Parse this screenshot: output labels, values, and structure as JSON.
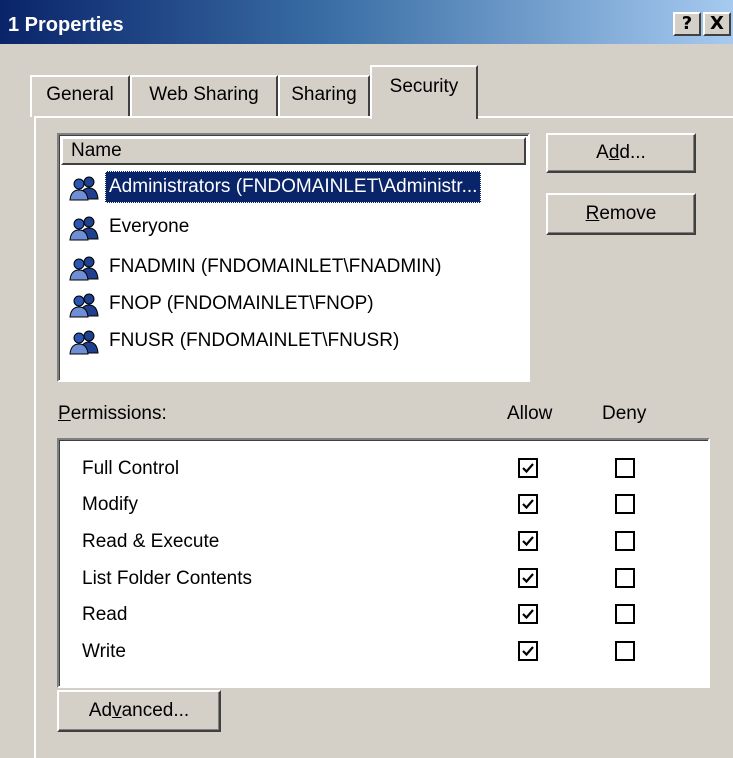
{
  "window": {
    "title": "1 Properties",
    "help_button": "?",
    "close_button": "X"
  },
  "tabs": [
    {
      "label": "General",
      "active": false
    },
    {
      "label": "Web Sharing",
      "active": false
    },
    {
      "label": "Sharing",
      "active": false
    },
    {
      "label": "Security",
      "active": true
    }
  ],
  "names_list": {
    "header": "Name",
    "items": [
      {
        "label": "Administrators (FNDOMAINLET\\Administr...",
        "icon": "group-icon",
        "selected": true
      },
      {
        "label": "Everyone",
        "icon": "group-icon",
        "selected": false
      },
      {
        "label": "FNADMIN (FNDOMAINLET\\FNADMIN)",
        "icon": "group-icon",
        "selected": false
      },
      {
        "label": "FNOP (FNDOMAINLET\\FNOP)",
        "icon": "group-icon",
        "selected": false
      },
      {
        "label": "FNUSR (FNDOMAINLET\\FNUSR)",
        "icon": "group-icon",
        "selected": false
      }
    ]
  },
  "buttons": {
    "add_pre": "A",
    "add_mnemonic": "d",
    "add_post": "d...",
    "remove_mnemonic": "R",
    "remove_post": "emove",
    "advanced_pre": "Ad",
    "advanced_mnemonic": "v",
    "advanced_post": "anced..."
  },
  "permissions": {
    "label_mnemonic": "P",
    "label_post": "ermissions:",
    "allow_header": "Allow",
    "deny_header": "Deny",
    "rows": [
      {
        "name": "Full Control",
        "allow": true,
        "deny": false
      },
      {
        "name": "Modify",
        "allow": true,
        "deny": false
      },
      {
        "name": "Read & Execute",
        "allow": true,
        "deny": false
      },
      {
        "name": "List Folder Contents",
        "allow": true,
        "deny": false
      },
      {
        "name": "Read",
        "allow": true,
        "deny": false
      },
      {
        "name": "Write",
        "allow": true,
        "deny": false
      }
    ]
  },
  "colors": {
    "title_bar": "#0a246a",
    "selection": "#0a246a",
    "face": "#d4d0c8"
  }
}
